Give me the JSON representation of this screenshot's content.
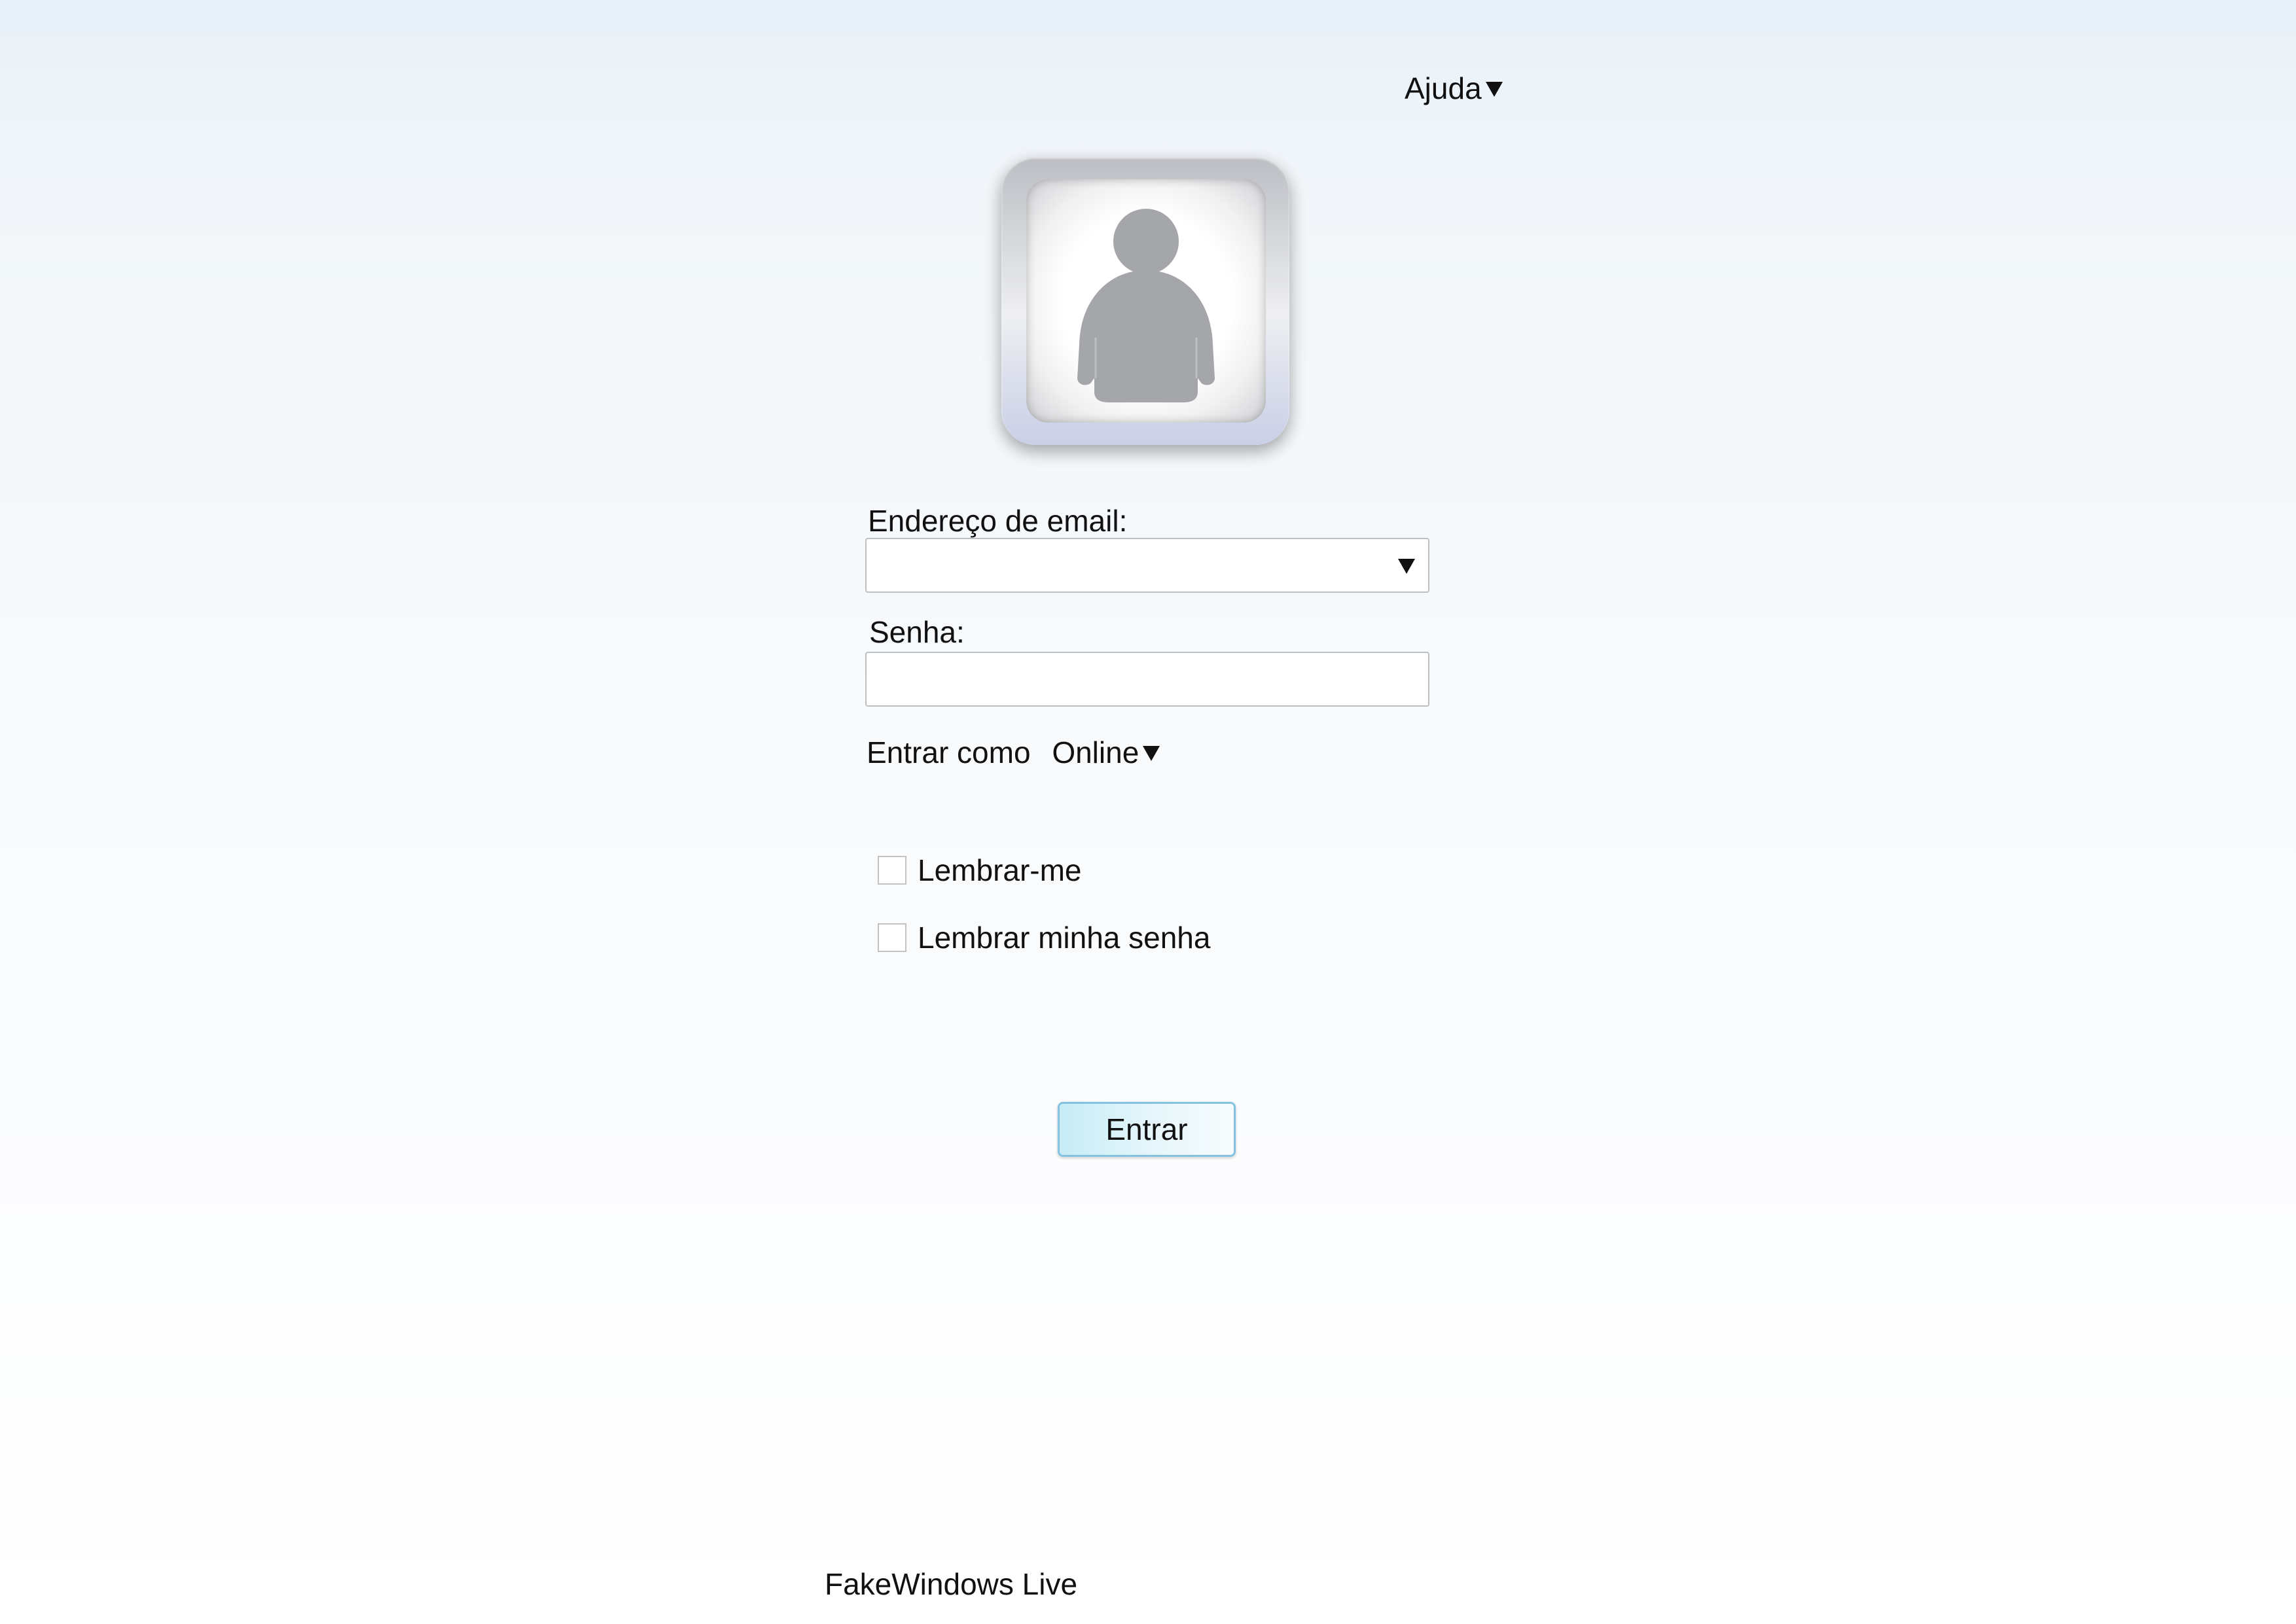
{
  "help_menu": {
    "label": "Ajuda"
  },
  "avatar": {
    "icon": "user-silhouette-icon",
    "frame_color": "#c9cfe6",
    "figure_color": "#a4a6aa"
  },
  "email": {
    "label": "Endereço de email:",
    "value": ""
  },
  "password": {
    "label": "Senha:",
    "value": ""
  },
  "status": {
    "prefix": "Entrar como",
    "selected": "Online"
  },
  "options": {
    "remember_me": {
      "label": "Lembrar-me",
      "checked": false
    },
    "remember_password": {
      "label": "Lembrar minha senha",
      "checked": false
    }
  },
  "signin_button": {
    "label": "Entrar",
    "accent": "#84c2e2"
  },
  "footer": {
    "brand": "FakeWindows Live"
  }
}
